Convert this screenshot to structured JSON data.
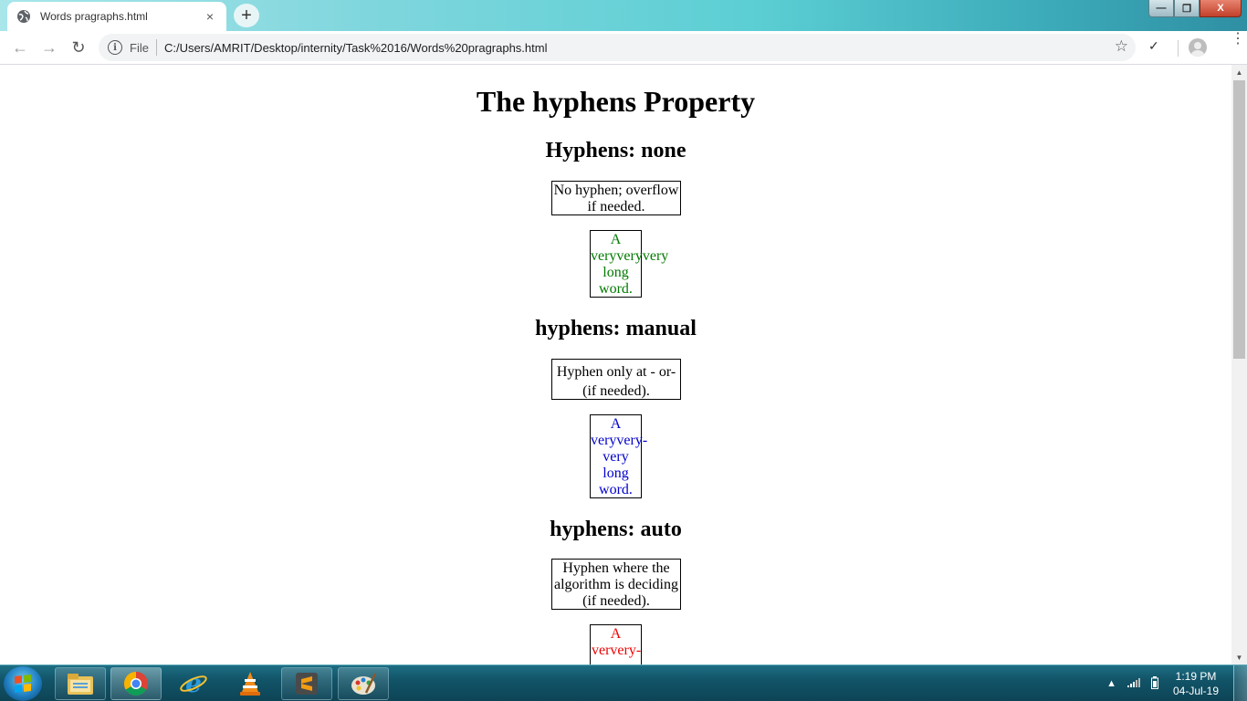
{
  "browser": {
    "tab_title": "Words pragraphs.html",
    "tab_close": "×",
    "new_tab": "+",
    "address_scheme_label": "File",
    "address_url": "C:/Users/AMRIT/Desktop/internity/Task%2016/Words%20pragraphs.html",
    "info_glyph": "i",
    "star_glyph": "☆",
    "check_glyph": "✓",
    "menu_glyph": "⋮",
    "back_glyph": "←",
    "forward_glyph": "→",
    "reload_glyph": "↻",
    "win_minimize": "—",
    "win_restore": "❐",
    "win_close": "X"
  },
  "page": {
    "title": "The hyphens Property",
    "sections": [
      {
        "heading": "Hyphens: none",
        "box1_lines": [
          "No hyphen; overflow",
          "if needed."
        ],
        "box2_lines": [
          "A",
          "veryveryvery",
          "long",
          "word."
        ],
        "box2_color": "#007a00"
      },
      {
        "heading": "hyphens: manual",
        "box1_lines": [
          "Hyphen only at - or-",
          "(if needed)."
        ],
        "box2_lines": [
          "A",
          "veryvery-",
          "very",
          "long",
          "word."
        ],
        "box2_color": "#0000cc"
      },
      {
        "heading": "hyphens: auto",
        "box1_lines": [
          "Hyphen where the",
          "algorithm is deciding",
          "(if needed)."
        ],
        "box2_lines": [
          "A",
          "ververy-"
        ],
        "box2_color": "#ee0000"
      }
    ]
  },
  "taskbar": {
    "apps": [
      "file-explorer",
      "chrome",
      "internet-explorer",
      "vlc",
      "sublime-text",
      "paint"
    ],
    "clock_time": "1:19 PM",
    "clock_date": "04-Jul-19",
    "tray_arrow": "▲"
  },
  "colors": {
    "titlebar_accent": "#5ccfd4",
    "taskbar": "#125468"
  }
}
